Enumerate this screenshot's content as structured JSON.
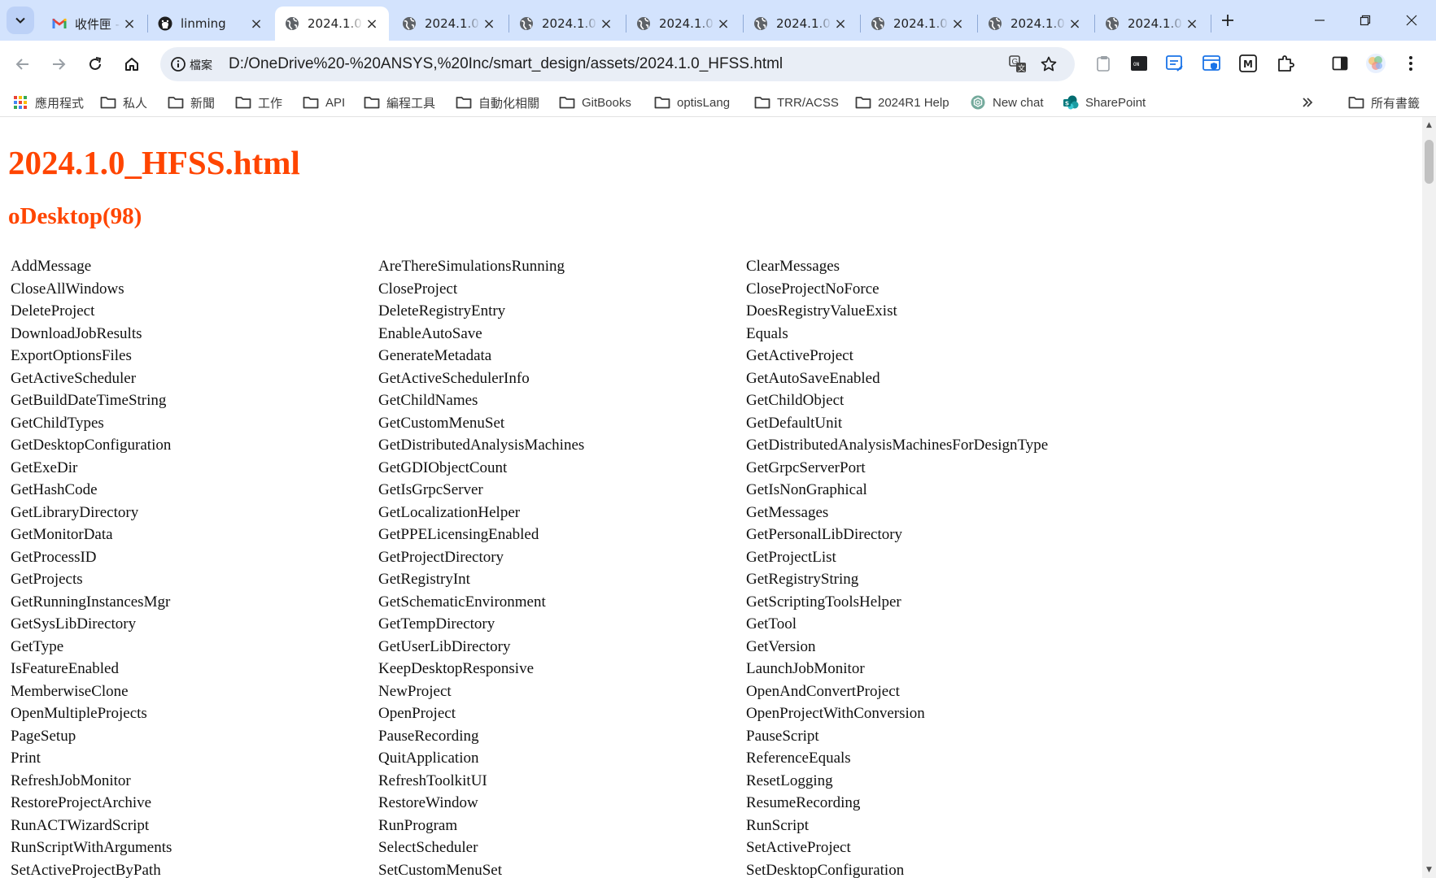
{
  "tabs": [
    {
      "title": "收件匣 -",
      "favicon": "gmail-icon",
      "active": false
    },
    {
      "title": "linming",
      "favicon": "github-icon",
      "active": false
    },
    {
      "title": "2024.1.0",
      "favicon": "globe-icon",
      "active": true
    },
    {
      "title": "2024.1.0",
      "favicon": "globe-icon",
      "active": false
    },
    {
      "title": "2024.1.0",
      "favicon": "globe-icon",
      "active": false
    },
    {
      "title": "2024.1.0",
      "favicon": "globe-icon",
      "active": false
    },
    {
      "title": "2024.1.0",
      "favicon": "globe-icon",
      "active": false
    },
    {
      "title": "2024.1.0",
      "favicon": "globe-icon",
      "active": false
    },
    {
      "title": "2024.1.0",
      "favicon": "globe-icon",
      "active": false
    },
    {
      "title": "2024.1.0",
      "favicon": "globe-icon",
      "active": false
    }
  ],
  "omnibox": {
    "label": "檔案",
    "url": "D:/OneDrive%20-%20ANSYS,%20Inc/smart_design/assets/2024.1.0_HFSS.html"
  },
  "bookmarks": [
    {
      "label": "應用程式",
      "icon": "apps-grid-icon"
    },
    {
      "label": "私人",
      "icon": "folder-icon"
    },
    {
      "label": "新聞",
      "icon": "folder-icon"
    },
    {
      "label": "工作",
      "icon": "folder-icon"
    },
    {
      "label": "API",
      "icon": "folder-icon"
    },
    {
      "label": "編程工具",
      "icon": "folder-icon"
    },
    {
      "label": "自動化相關",
      "icon": "folder-icon"
    },
    {
      "label": "GitBooks",
      "icon": "folder-icon"
    },
    {
      "label": "optisLang",
      "icon": "folder-icon"
    },
    {
      "label": "TRR/ACSS",
      "icon": "folder-icon"
    },
    {
      "label": "2024R1 Help",
      "icon": "folder-icon"
    },
    {
      "label": "New chat",
      "icon": "chatgpt-icon"
    },
    {
      "label": "SharePoint",
      "icon": "sharepoint-icon"
    }
  ],
  "all_bookmarks_label": "所有書籤",
  "page": {
    "title": "2024.1.0_HFSS.html",
    "section_title": "oDesktop(98)",
    "methods": [
      "AddMessage",
      "AreThereSimulationsRunning",
      "ClearMessages",
      "CloseAllWindows",
      "CloseProject",
      "CloseProjectNoForce",
      "DeleteProject",
      "DeleteRegistryEntry",
      "DoesRegistryValueExist",
      "DownloadJobResults",
      "EnableAutoSave",
      "Equals",
      "ExportOptionsFiles",
      "GenerateMetadata",
      "GetActiveProject",
      "GetActiveScheduler",
      "GetActiveSchedulerInfo",
      "GetAutoSaveEnabled",
      "GetBuildDateTimeString",
      "GetChildNames",
      "GetChildObject",
      "GetChildTypes",
      "GetCustomMenuSet",
      "GetDefaultUnit",
      "GetDesktopConfiguration",
      "GetDistributedAnalysisMachines",
      "GetDistributedAnalysisMachinesForDesignType",
      "GetExeDir",
      "GetGDIObjectCount",
      "GetGrpcServerPort",
      "GetHashCode",
      "GetIsGrpcServer",
      "GetIsNonGraphical",
      "GetLibraryDirectory",
      "GetLocalizationHelper",
      "GetMessages",
      "GetMonitorData",
      "GetPPELicensingEnabled",
      "GetPersonalLibDirectory",
      "GetProcessID",
      "GetProjectDirectory",
      "GetProjectList",
      "GetProjects",
      "GetRegistryInt",
      "GetRegistryString",
      "GetRunningInstancesMgr",
      "GetSchematicEnvironment",
      "GetScriptingToolsHelper",
      "GetSysLibDirectory",
      "GetTempDirectory",
      "GetTool",
      "GetType",
      "GetUserLibDirectory",
      "GetVersion",
      "IsFeatureEnabled",
      "KeepDesktopResponsive",
      "LaunchJobMonitor",
      "MemberwiseClone",
      "NewProject",
      "OpenAndConvertProject",
      "OpenMultipleProjects",
      "OpenProject",
      "OpenProjectWithConversion",
      "PageSetup",
      "PauseRecording",
      "PauseScript",
      "Print",
      "QuitApplication",
      "ReferenceEquals",
      "RefreshJobMonitor",
      "RefreshToolkitUI",
      "ResetLogging",
      "RestoreProjectArchive",
      "RestoreWindow",
      "ResumeRecording",
      "RunACTWizardScript",
      "RunProgram",
      "RunScript",
      "RunScriptWithArguments",
      "SelectScheduler",
      "SetActiveProject",
      "SetActiveProjectByPath",
      "SetCustomMenuSet",
      "SetDesktopConfiguration"
    ]
  },
  "colors": {
    "heading": "#ff4500",
    "tabstrip": "#d3e3fd",
    "omnibox": "#e9eef6"
  }
}
